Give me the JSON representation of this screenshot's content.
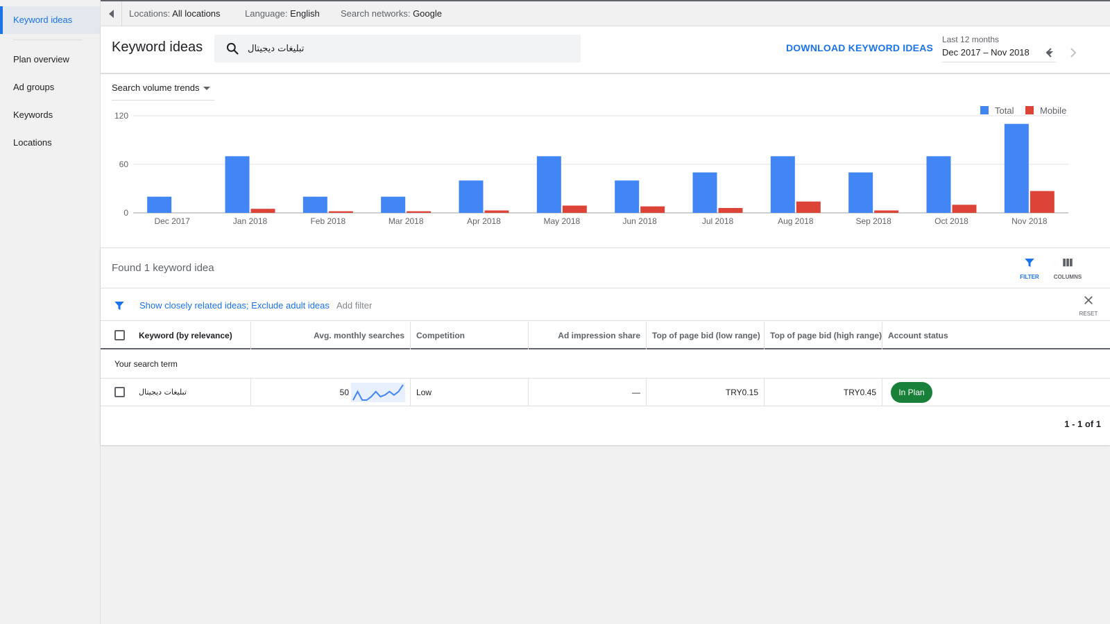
{
  "sidebar": {
    "items": [
      {
        "label": "Keyword ideas",
        "active": true
      },
      {
        "label": "Plan overview"
      },
      {
        "label": "Ad groups"
      },
      {
        "label": "Keywords"
      },
      {
        "label": "Locations"
      }
    ]
  },
  "topbar": {
    "locations_key": "Locations:",
    "locations_val": "All locations",
    "language_key": "Language:",
    "language_val": "English",
    "networks_key": "Search networks:",
    "networks_val": "Google"
  },
  "header": {
    "title": "Keyword ideas",
    "search_value": "تبليغات ديجيتال",
    "download_label": "DOWNLOAD KEYWORD IDEAS",
    "date_caption": "Last 12 months",
    "date_range": "Dec 2017 – Nov 2018"
  },
  "chart": {
    "selector_label": "Search volume trends",
    "legend": [
      {
        "label": "Total",
        "color": "#4285f4"
      },
      {
        "label": "Mobile",
        "color": "#db4437"
      }
    ]
  },
  "chart_data": {
    "type": "bar",
    "categories": [
      "Dec 2017",
      "Jan 2018",
      "Feb 2018",
      "Mar 2018",
      "Apr 2018",
      "May 2018",
      "Jun 2018",
      "Jul 2018",
      "Aug 2018",
      "Sep 2018",
      "Oct 2018",
      "Nov 2018"
    ],
    "series": [
      {
        "name": "Total",
        "color": "#4285f4",
        "values": [
          20,
          70,
          20,
          20,
          40,
          70,
          40,
          50,
          70,
          50,
          70,
          110
        ]
      },
      {
        "name": "Mobile",
        "color": "#db4437",
        "values": [
          0,
          5,
          2,
          2,
          3,
          9,
          8,
          6,
          14,
          3,
          10,
          27
        ]
      }
    ],
    "y_ticks": [
      0,
      60,
      120
    ],
    "ylim": [
      0,
      120
    ],
    "grid": true,
    "legend_position": "top-right"
  },
  "results": {
    "found_text": "Found 1 keyword idea",
    "filter_label": "FILTER",
    "columns_label": "COLUMNS",
    "filter_link": "Show closely related ideas; Exclude adult ideas",
    "add_filter": "Add filter",
    "reset_label": "RESET",
    "columns": [
      "Keyword (by relevance)",
      "Avg. monthly searches",
      "Competition",
      "Ad impression share",
      "Top of page bid (low range)",
      "Top of page bid (high range)",
      "Account status"
    ],
    "group_label": "Your search term",
    "rows": [
      {
        "keyword": "تبليغات ديجيتال",
        "avg_searches": "50",
        "trend": [
          20,
          70,
          20,
          20,
          40,
          70,
          40,
          50,
          70,
          50,
          70,
          110
        ],
        "competition": "Low",
        "impression_share": "—",
        "bid_low": "TRY0.15",
        "bid_high": "TRY0.45",
        "status": "In Plan"
      }
    ],
    "pagination": "1 - 1 of 1"
  }
}
